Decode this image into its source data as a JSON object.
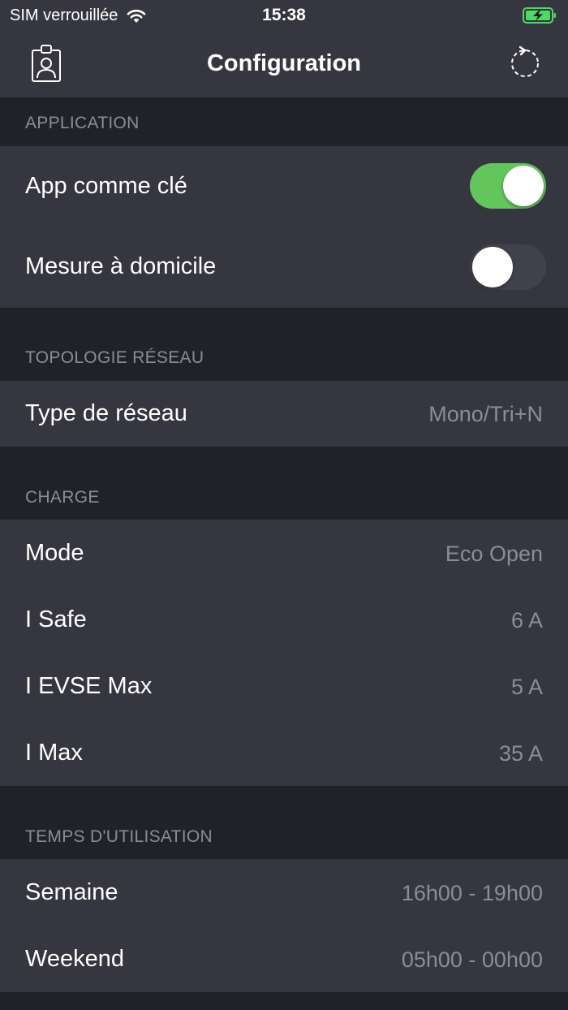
{
  "status_bar": {
    "carrier": "SIM verrouillée",
    "time": "15:38",
    "battery_color": "#4cd964"
  },
  "nav": {
    "title": "Configuration",
    "left_icon": "badge-icon",
    "right_icon": "refresh-icon"
  },
  "sections": {
    "application": {
      "header": "APPLICATION",
      "app_as_key": {
        "label": "App comme clé",
        "enabled": true
      },
      "home_measure": {
        "label": "Mesure à domicile",
        "enabled": false
      }
    },
    "topology": {
      "header": "TOPOLOGIE RÉSEAU",
      "network_type": {
        "label": "Type de réseau",
        "value": "Mono/Tri+N"
      }
    },
    "charge": {
      "header": "CHARGE",
      "mode": {
        "label": "Mode",
        "value": "Eco Open"
      },
      "i_safe": {
        "label": "I Safe",
        "value": "6 A"
      },
      "i_evse_max": {
        "label": "I EVSE Max",
        "value": "5 A"
      },
      "i_max": {
        "label": "I Max",
        "value": "35 A"
      }
    },
    "usage_time": {
      "header": "TEMPS D'UTILISATION",
      "week": {
        "label": "Semaine",
        "value": "16h00 - 19h00"
      },
      "weekend": {
        "label": "Weekend",
        "value": "05h00 - 00h00"
      }
    }
  },
  "colors": {
    "background": "#212128",
    "cell": "#363640",
    "secondary_text": "#8c8c95",
    "switch_on": "#62c65c"
  }
}
